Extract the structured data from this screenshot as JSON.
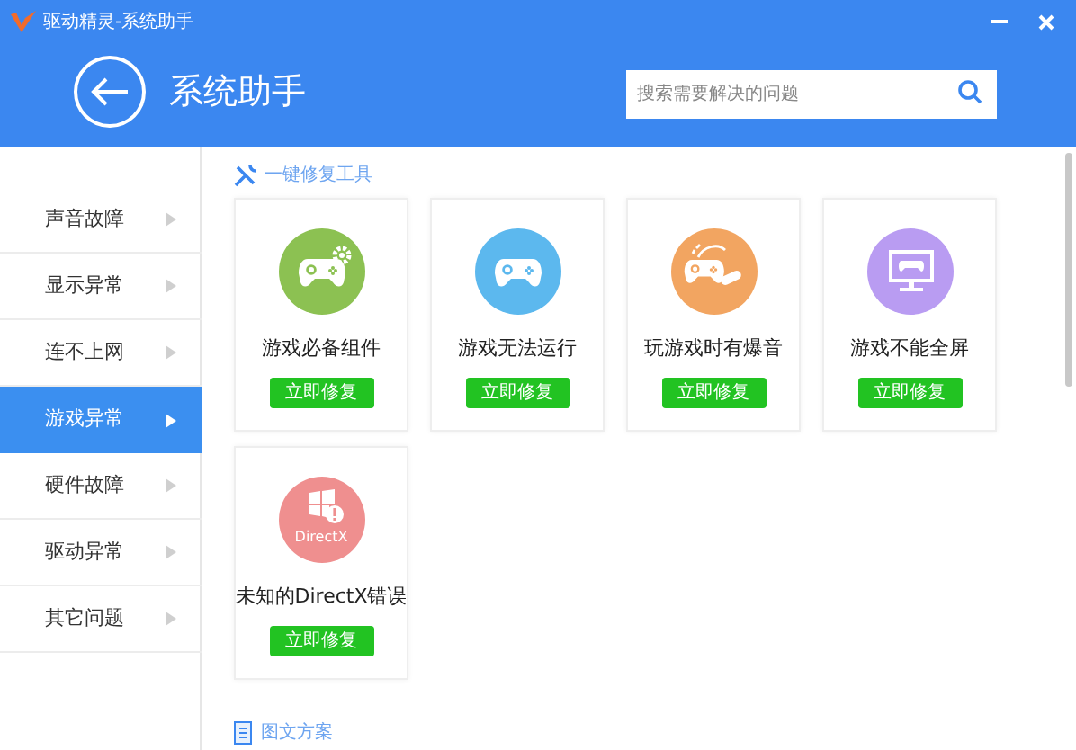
{
  "window": {
    "title": "驱动精灵-系统助手"
  },
  "header": {
    "title": "系统助手"
  },
  "search": {
    "placeholder": "搜索需要解决的问题"
  },
  "sidebar": {
    "items": [
      {
        "label": "声音故障",
        "selected": false
      },
      {
        "label": "显示异常",
        "selected": false
      },
      {
        "label": "连不上网",
        "selected": false
      },
      {
        "label": "游戏异常",
        "selected": true
      },
      {
        "label": "硬件故障",
        "selected": false
      },
      {
        "label": "驱动异常",
        "selected": false
      },
      {
        "label": "其它问题",
        "selected": false
      }
    ]
  },
  "repair_section": {
    "title": "一键修复工具",
    "cards": [
      {
        "kind": "gamepad-gear",
        "color": "#8cc152",
        "title": "游戏必备组件",
        "button": "立即修复"
      },
      {
        "kind": "gamepad",
        "color": "#5cb8ee",
        "title": "游戏无法运行",
        "button": "立即修复"
      },
      {
        "kind": "gamepad-plug",
        "color": "#f2a561",
        "title": "玩游戏时有爆音",
        "button": "立即修复"
      },
      {
        "kind": "monitor",
        "color": "#b99cf2",
        "title": "游戏不能全屏",
        "button": "立即修复"
      },
      {
        "kind": "directx",
        "color": "#ef8f8f",
        "icon_label": "DirectX",
        "title": "未知的DirectX错误",
        "button": "立即修复"
      }
    ]
  },
  "guide_section": {
    "title": "图文方案"
  }
}
